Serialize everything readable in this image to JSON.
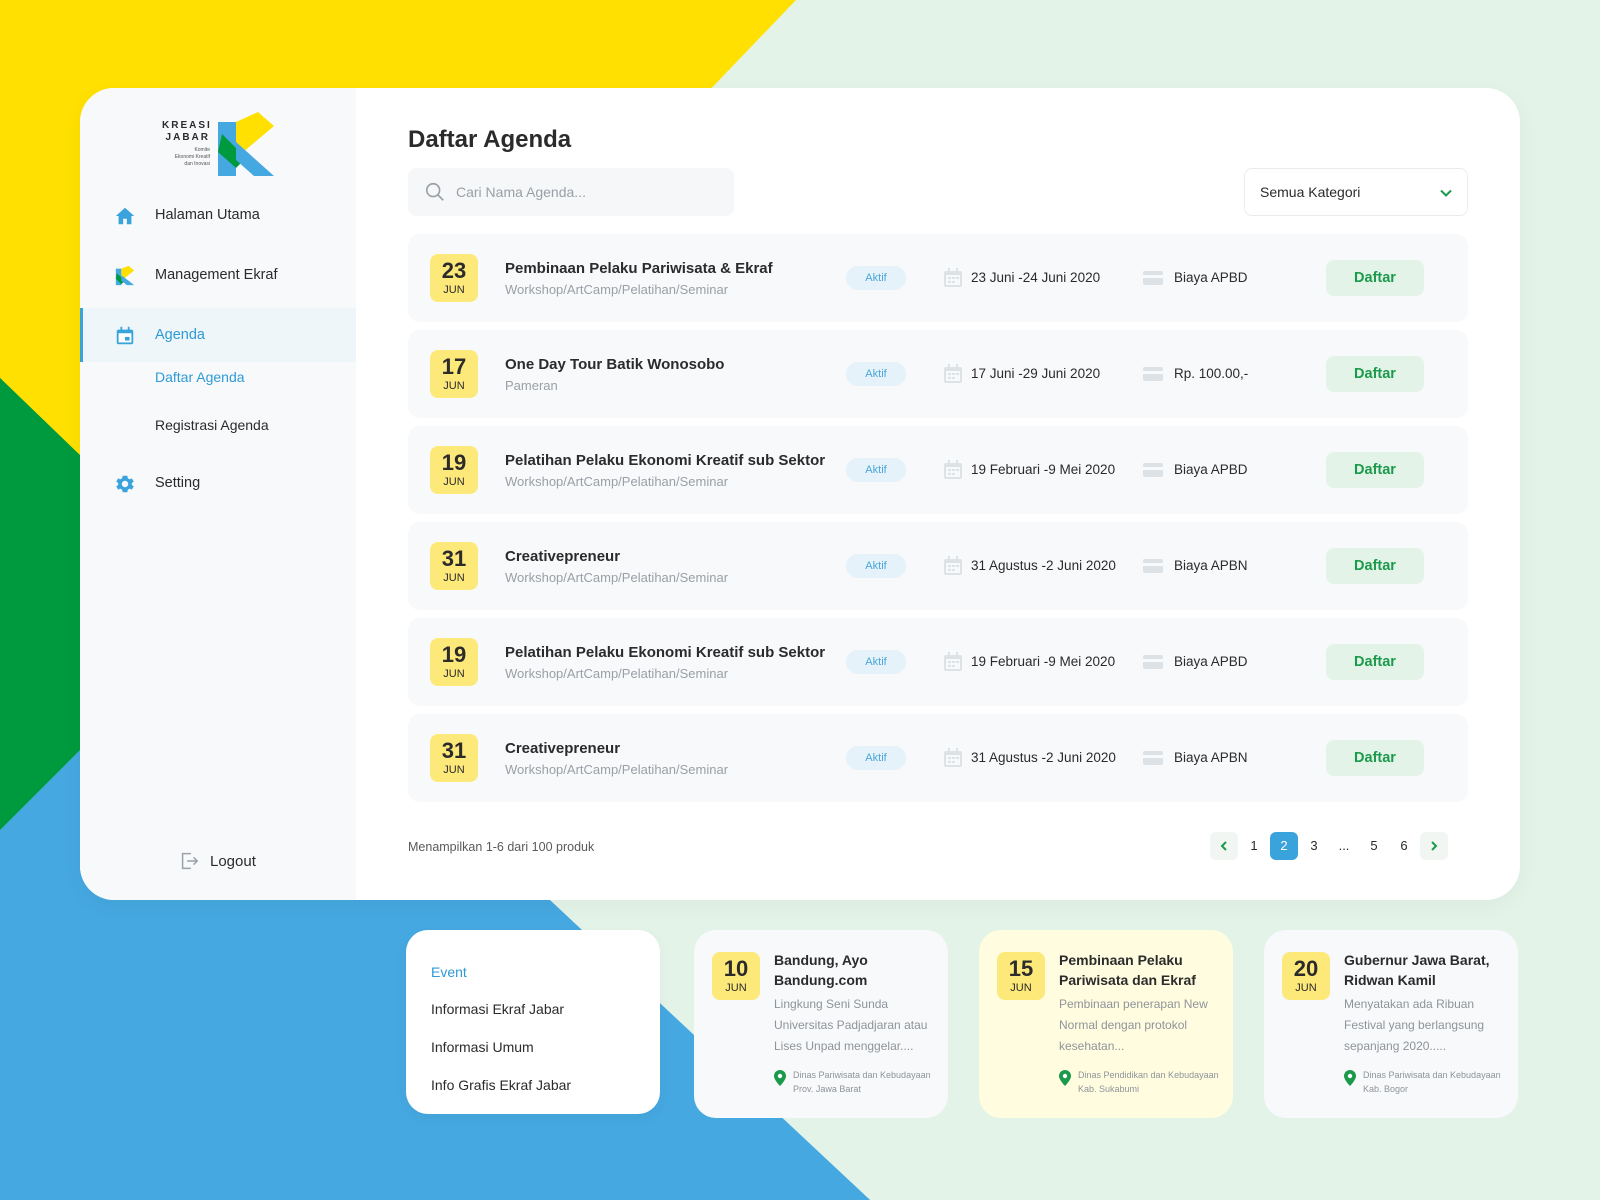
{
  "brand": {
    "word1": "KREASI",
    "word2": "JABAR",
    "tagline1": "Komite",
    "tagline2": "Ekonomi Kreatif",
    "tagline3": "dan Inovasi"
  },
  "colors": {
    "yellow": "#FFE000",
    "green": "#009A3E",
    "blue": "#45A8E0",
    "mint": "#E3F3E8",
    "accent": "#3BA3DC",
    "badge": "#FDE87A",
    "button_text": "#1C9A4B"
  },
  "sidebar": {
    "items": [
      {
        "label": "Halaman Utama",
        "icon": "home-icon"
      },
      {
        "label": "Management Ekraf",
        "icon": "ekraf-logo-icon"
      },
      {
        "label": "Agenda",
        "icon": "calendar-icon",
        "active": true
      },
      {
        "label": "Setting",
        "icon": "gear-icon"
      }
    ],
    "sub_items": [
      {
        "label": "Daftar Agenda",
        "active": true
      },
      {
        "label": "Registrasi Agenda"
      }
    ],
    "logout": "Logout"
  },
  "main": {
    "title": "Daftar Agenda",
    "search_placeholder": "Cari Nama Agenda...",
    "category": "Semua Kategori",
    "agenda": [
      {
        "day": "23",
        "month": "JUN",
        "title": "Pembinaan Pelaku Pariwisata & Ekraf",
        "category": "Workshop/ArtCamp/Pelatihan/Seminar",
        "status": "Aktif",
        "period": "23 Juni -24 Juni 2020",
        "cost": "Biaya APBD",
        "action": "Daftar"
      },
      {
        "day": "17",
        "month": "JUN",
        "title": "One Day Tour Batik Wonosobo",
        "category": "Pameran",
        "status": "Aktif",
        "period": "17 Juni -29 Juni 2020",
        "cost": "Rp. 100.00,-",
        "action": "Daftar"
      },
      {
        "day": "19",
        "month": "JUN",
        "title": "Pelatihan Pelaku Ekonomi Kreatif sub Sektor",
        "category": "Workshop/ArtCamp/Pelatihan/Seminar",
        "status": "Aktif",
        "period": "19 Februari -9 Mei 2020",
        "cost": "Biaya APBD",
        "action": "Daftar"
      },
      {
        "day": "31",
        "month": "JUN",
        "title": "Creativepreneur",
        "category": "Workshop/ArtCamp/Pelatihan/Seminar",
        "status": "Aktif",
        "period": "31 Agustus -2 Juni 2020",
        "cost": "Biaya APBN",
        "action": "Daftar"
      },
      {
        "day": "19",
        "month": "JUN",
        "title": "Pelatihan Pelaku Ekonomi Kreatif sub Sektor",
        "category": "Workshop/ArtCamp/Pelatihan/Seminar",
        "status": "Aktif",
        "period": "19 Februari -9 Mei 2020",
        "cost": "Biaya APBD",
        "action": "Daftar"
      },
      {
        "day": "31",
        "month": "JUN",
        "title": "Creativepreneur",
        "category": "Workshop/ArtCamp/Pelatihan/Seminar",
        "status": "Aktif",
        "period": "31 Agustus -2 Juni 2020",
        "cost": "Biaya APBN",
        "action": "Daftar"
      }
    ],
    "showing": "Menampilkan 1-6 dari 100 produk",
    "pagination": {
      "pages": [
        "1",
        "2",
        "3",
        "...",
        "5",
        "6"
      ],
      "current": "2"
    }
  },
  "bottom": {
    "menu": [
      {
        "label": "Event",
        "active": true
      },
      {
        "label": "Informasi Ekraf Jabar"
      },
      {
        "label": "Informasi Umum"
      },
      {
        "label": "Info Grafis Ekraf Jabar"
      }
    ],
    "news": [
      {
        "day": "10",
        "month": "JUN",
        "title": "Bandung, Ayo Bandung.com",
        "body": "Lingkung Seni Sunda Universitas Padjadjaran atau Lises Unpad menggelar....",
        "location": "Dinas Pariwisata dan Kebudayaan Prov. Jawa Barat"
      },
      {
        "day": "15",
        "month": "JUN",
        "title": "Pembinaan Pelaku Pariwisata dan Ekraf",
        "body": "Pembinaan penerapan New Normal dengan protokol kesehatan...",
        "location": "Dinas Pendidikan dan Kebudayaan Kab. Sukabumi",
        "highlight": true
      },
      {
        "day": "20",
        "month": "JUN",
        "title": "Gubernur Jawa Barat, Ridwan Kamil",
        "body": "Menyatakan ada Ribuan Festival yang berlangsung sepanjang 2020.....",
        "location": "Dinas Pariwisata dan Kebudayaan Kab. Bogor"
      }
    ]
  }
}
